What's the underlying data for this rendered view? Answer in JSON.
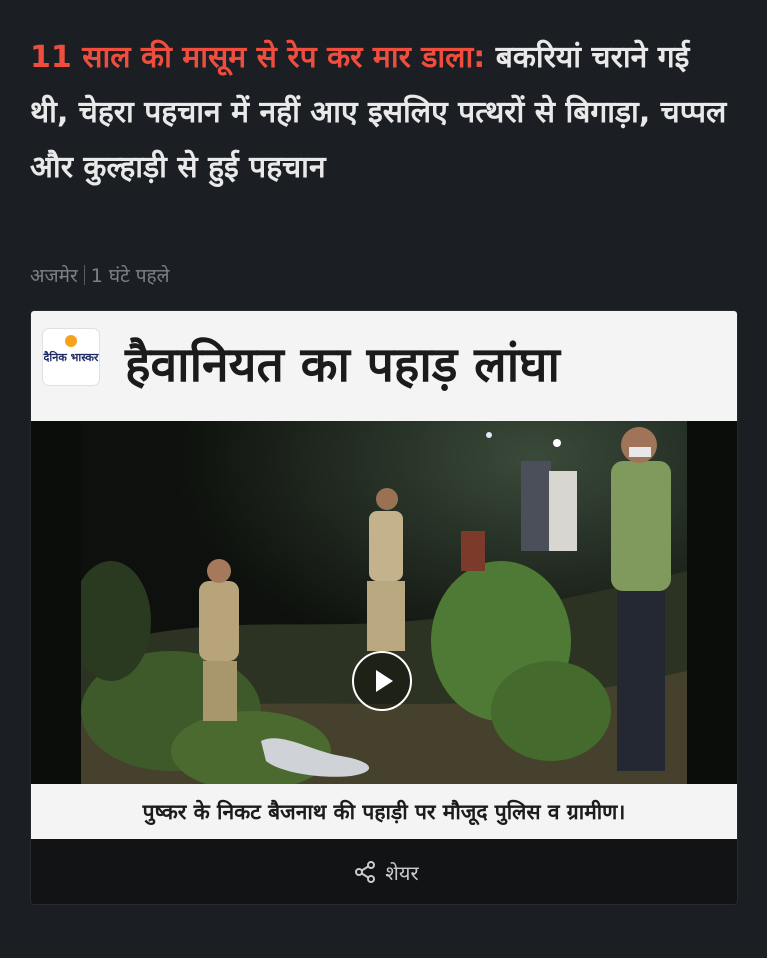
{
  "article": {
    "headline_kicker": "11 साल की मासूम से रेप कर मार डाला:",
    "headline_rest": " बकरियां चराने गई थी, चेहरा पहचान में नहीं आए इसलिए पत्थरों से बिगाड़ा, चप्पल और कुल्हाड़ी से हुई पहचान",
    "location": "अजमेर",
    "time_ago": "1 घंटे पहले"
  },
  "media": {
    "logo_text": "दैनिक भास्कर",
    "banner_title": "हैवानियत का पहाड़ लांघा",
    "caption": "पुष्कर के निकट बैजनाथ की पहाड़ी पर मौजूद पुलिस व ग्रामीण।",
    "share_label": "शेयर"
  },
  "colors": {
    "background": "#1b1f23",
    "headline_accent": "#ef4d3d",
    "headline_text": "#e9e9e9",
    "meta_text": "#7d8186"
  },
  "icons": {
    "play": "play-icon",
    "share": "share-icon"
  }
}
